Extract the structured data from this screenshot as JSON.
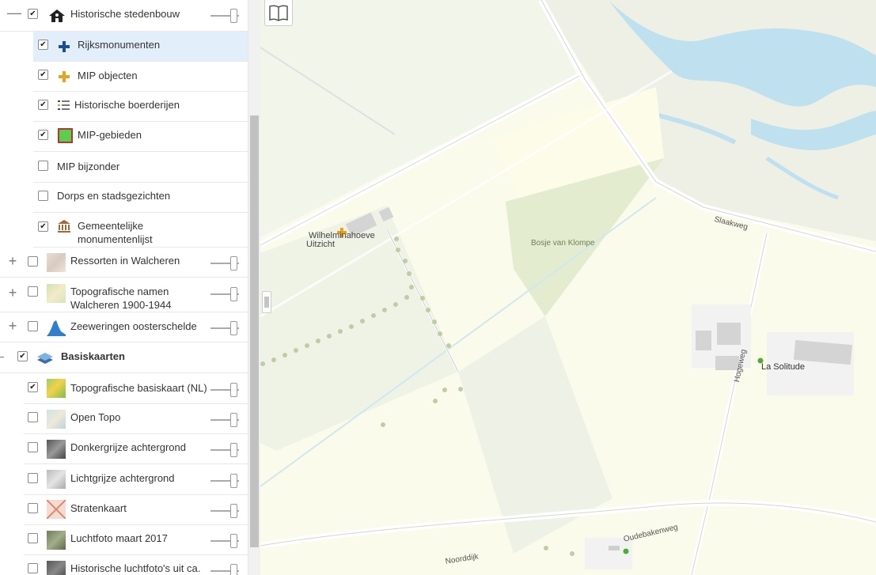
{
  "layers": {
    "historische_stedenbouw": "Historische stedenbouw",
    "rijksmonumenten": "Rijksmonumenten",
    "mip_objecten": "MIP objecten",
    "historische_boerderijen": "Historische boerderijen",
    "mip_gebieden": "MIP-gebieden",
    "mip_bijzonder": "MIP bijzonder",
    "dorps_en_stadsgezichten": "Dorps en stadsgezichten",
    "gemeentelijke_1": "Gemeentelijke",
    "gemeentelijke_2": "monumentenlijst",
    "ressorten": "Ressorten in Walcheren",
    "topografische_namen_1": "Topografische namen",
    "topografische_namen_2": "Walcheren 1900-1944",
    "zeeweringen": "Zeeweringen oosterschelde",
    "basiskaarten": "Basiskaarten",
    "topo_basiskaart": "Topografische basiskaart (NL)",
    "open_topo": "Open Topo",
    "donkergrijs": "Donkergrijze achtergrond",
    "lichtgrijs": "Lichtgrijze achtergrond",
    "stratenkaart": "Stratenkaart",
    "luchtfoto": "Luchtfoto maart 2017",
    "historische_luchtfoto": "Historische luchtfoto's uit ca."
  },
  "map_labels": {
    "wilhelminahoeve": "Wilhelminahoeve",
    "uitzicht": "Uitzicht",
    "bosje": "Bosje van Klompe",
    "slaakweg": "Slaakweg",
    "hogeweg": "Hogeweg",
    "la_solitude": "La Solitude",
    "oudebakenweg": "Oudebakenweg",
    "noorddijk": "Noorddijk"
  },
  "glyphs": {
    "check": "✔",
    "minus": "—",
    "plus": "+",
    "chevron": "›"
  },
  "colors": {
    "selected_row": "#e2effb",
    "water": "#bfe1ef",
    "mip_orange": "#e8a21d",
    "rijks_blue": "#1b4f9c"
  }
}
